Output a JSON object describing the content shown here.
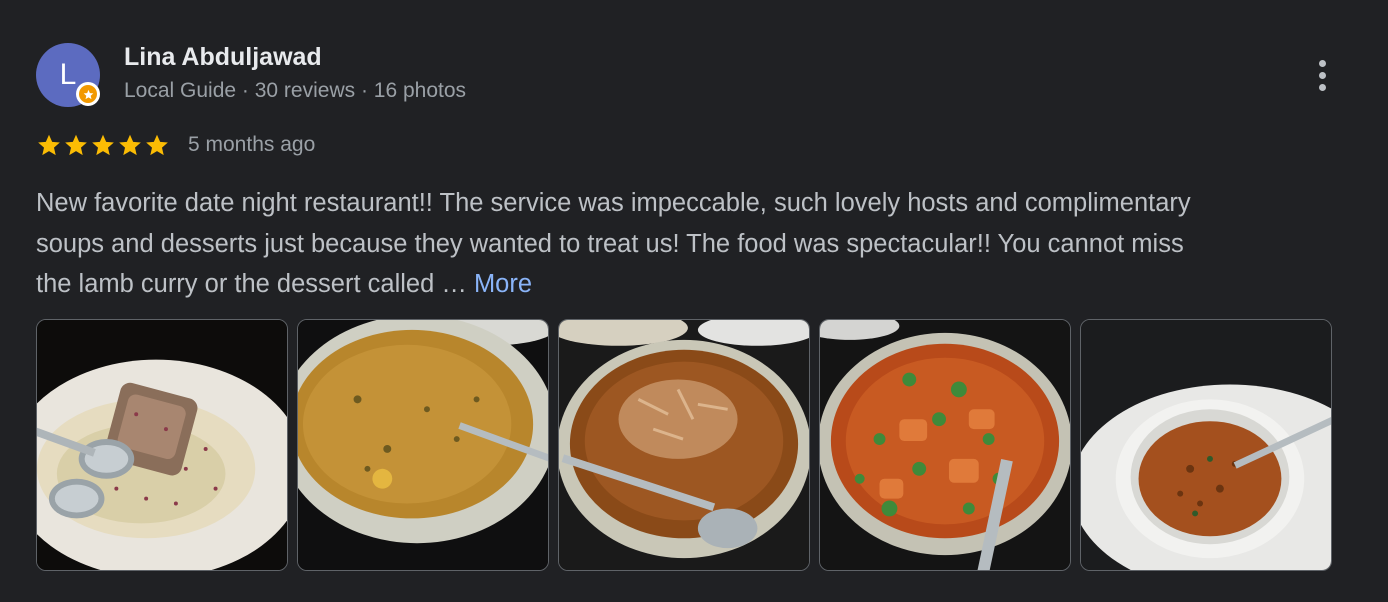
{
  "reviewer": {
    "initial": "L",
    "name": "Lina Abduljawad",
    "meta": "Local Guide · 30 reviews · 16 photos",
    "avatar_color": "#5c6bc0",
    "badge_icon": "local-guide-star-icon"
  },
  "rating": {
    "stars": 5,
    "max": 5,
    "star_color": "#fbbc04",
    "time_ago": "5 months ago"
  },
  "review": {
    "lines": [
      "New favorite date night restaurant!! The service was impeccable, such lovely hosts and complimentary",
      "soups and desserts just because they wanted to treat us! The food was spectacular!! You cannot miss",
      "the lamb curry or the dessert called … "
    ],
    "more_label": "More"
  },
  "photos": [
    {
      "icon": "dessert-plate-photo"
    },
    {
      "icon": "yellow-curry-bowl-photo"
    },
    {
      "icon": "lamb-curry-bowl-photo"
    },
    {
      "icon": "chicken-curry-bowl-photo"
    },
    {
      "icon": "soup-cup-photo"
    }
  ],
  "colors": {
    "background": "#202124",
    "primary_text": "#e8eaed",
    "secondary_text": "#9aa0a6",
    "body_text": "#bdc1c6",
    "link": "#8ab4f8"
  }
}
